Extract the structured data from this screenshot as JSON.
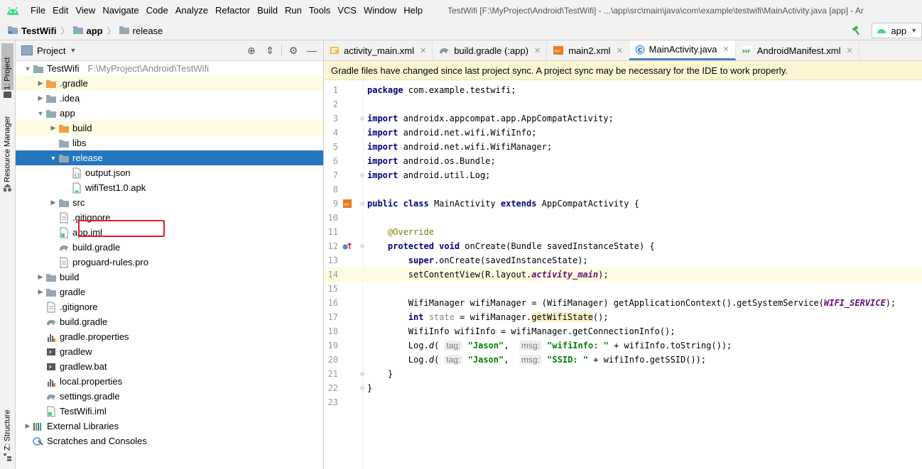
{
  "menubar": {
    "items": [
      "File",
      "Edit",
      "View",
      "Navigate",
      "Code",
      "Analyze",
      "Refactor",
      "Build",
      "Run",
      "Tools",
      "VCS",
      "Window",
      "Help"
    ],
    "title": "TestWifi [F:\\MyProject\\Android\\TestWifi] - ...\\app\\src\\main\\java\\com\\example\\testwifi\\MainActivity.java [app] - Ar"
  },
  "navbar": {
    "crumbs": [
      "TestWifi",
      "app",
      "release"
    ],
    "run_config": "app"
  },
  "side_strip": {
    "tabs": [
      "1: Project",
      "Resource Manager",
      "Z: Structure"
    ]
  },
  "project_panel": {
    "title": "Project",
    "tree": [
      {
        "label": "TestWifi",
        "path": "F:\\MyProject\\Android\\TestWifi",
        "depth": 0,
        "arrow": "open",
        "icon": "module-folder-icon"
      },
      {
        "label": ".gradle",
        "depth": 1,
        "arrow": "closed",
        "icon": "orange-folder-icon",
        "state": "highlight"
      },
      {
        "label": ".idea",
        "depth": 1,
        "arrow": "closed",
        "icon": "folder-icon"
      },
      {
        "label": "app",
        "depth": 1,
        "arrow": "open",
        "icon": "module-folder-icon"
      },
      {
        "label": "build",
        "depth": 2,
        "arrow": "closed",
        "icon": "orange-folder-icon",
        "state": "highlight"
      },
      {
        "label": "libs",
        "depth": 2,
        "arrow": "none",
        "icon": "folder-icon"
      },
      {
        "label": "release",
        "depth": 2,
        "arrow": "open",
        "icon": "folder-icon",
        "state": "selected"
      },
      {
        "label": "output.json",
        "depth": 3,
        "arrow": "none",
        "icon": "json-file-icon"
      },
      {
        "label": "wifiTest1.0.apk",
        "depth": 3,
        "arrow": "none",
        "icon": "apk-file-icon"
      },
      {
        "label": "src",
        "depth": 2,
        "arrow": "closed",
        "icon": "folder-icon"
      },
      {
        "label": ".gitignore",
        "depth": 2,
        "arrow": "none",
        "icon": "text-file-icon"
      },
      {
        "label": "app.iml",
        "depth": 2,
        "arrow": "none",
        "icon": "iml-file-icon"
      },
      {
        "label": "build.gradle",
        "depth": 2,
        "arrow": "none",
        "icon": "gradle-icon"
      },
      {
        "label": "proguard-rules.pro",
        "depth": 2,
        "arrow": "none",
        "icon": "text-file-icon"
      },
      {
        "label": "build",
        "depth": 1,
        "arrow": "closed",
        "icon": "folder-icon"
      },
      {
        "label": "gradle",
        "depth": 1,
        "arrow": "closed",
        "icon": "folder-icon"
      },
      {
        "label": ".gitignore",
        "depth": 1,
        "arrow": "none",
        "icon": "text-file-icon"
      },
      {
        "label": "build.gradle",
        "depth": 1,
        "arrow": "none",
        "icon": "gradle-icon"
      },
      {
        "label": "gradle.properties",
        "depth": 1,
        "arrow": "none",
        "icon": "properties-file-icon"
      },
      {
        "label": "gradlew",
        "depth": 1,
        "arrow": "none",
        "icon": "script-file-icon"
      },
      {
        "label": "gradlew.bat",
        "depth": 1,
        "arrow": "none",
        "icon": "script-file-icon"
      },
      {
        "label": "local.properties",
        "depth": 1,
        "arrow": "none",
        "icon": "properties-file-icon"
      },
      {
        "label": "settings.gradle",
        "depth": 1,
        "arrow": "none",
        "icon": "gradle-icon"
      },
      {
        "label": "TestWifi.iml",
        "depth": 1,
        "arrow": "none",
        "icon": "iml-file-icon"
      },
      {
        "label": "External Libraries",
        "depth": 0,
        "arrow": "closed",
        "icon": "libraries-icon"
      },
      {
        "label": "Scratches and Consoles",
        "depth": 0,
        "arrow": "none",
        "icon": "scratches-icon"
      }
    ]
  },
  "editor": {
    "tabs": [
      {
        "label": "activity_main.xml",
        "icon": "layout-xml-icon"
      },
      {
        "label": "build.gradle (:app)",
        "icon": "gradle-icon"
      },
      {
        "label": "main2.xml",
        "icon": "xml-file-icon"
      },
      {
        "label": "MainActivity.java",
        "icon": "class-icon",
        "active": true
      },
      {
        "label": "AndroidManifest.xml",
        "icon": "manifest-icon"
      }
    ],
    "notice": "Gradle files have changed since last project sync. A project sync may be necessary for the IDE to work properly.",
    "line_numbers": [
      "1",
      "2",
      "3",
      "4",
      "5",
      "6",
      "7",
      "8",
      "9",
      "10",
      "11",
      "12",
      "13",
      "14",
      "15",
      "16",
      "17",
      "18",
      "19",
      "20",
      "21",
      "22",
      "23"
    ],
    "code": {
      "l1_kw": "package",
      "l1_rest": " com.example.testwifi;",
      "import_kw": "import",
      "l3": " androidx.appcompat.app.AppCompatActivity;",
      "l4": " android.net.wifi.WifiInfo;",
      "l5": " android.net.wifi.WifiManager;",
      "l6": " android.os.Bundle;",
      "l7": " android.util.Log;",
      "l9_public": "public",
      "l9_class": "class",
      "l9_name": " MainActivity ",
      "l9_extends": "extends",
      "l9_rest": " AppCompatActivity {",
      "l11": "@Override",
      "l12_protected": "protected",
      "l12_void": "void",
      "l12_rest": " onCreate(Bundle savedInstanceState) {",
      "l13_super": "super",
      "l13_rest": ".onCreate(savedInstanceState);",
      "l14_a": "setContentView(R.layout.",
      "l14_b": "activity_main",
      "l14_c": ");",
      "l16_a": "WifiManager wifiManager = (WifiManager) getApplicationContext().getSystemService(",
      "l16_b": "WIFI_SERVICE",
      "l16_c": ");",
      "l17_int": "int",
      "l17_state": " state",
      "l17_a": " = wifiManager.",
      "l17_b": "getWifiState",
      "l17_c": "();",
      "l18": "WifiInfo wifiInfo = wifiManager.getConnectionInfo();",
      "log_a": "Log.",
      "log_d": "d",
      "log_paren": "(",
      "hint_tag": "tag:",
      "hint_msg": "msg:",
      "jason": "\"Jason\"",
      "comma": ",",
      "l19_str": "\"wifiInfo: \"",
      "l19_rest": " + wifiInfo.toString());",
      "l20_str": "\"SSID: \"",
      "l20_rest": " + wifiInfo.getSSID());",
      "l21": "}",
      "l22": "}"
    }
  }
}
